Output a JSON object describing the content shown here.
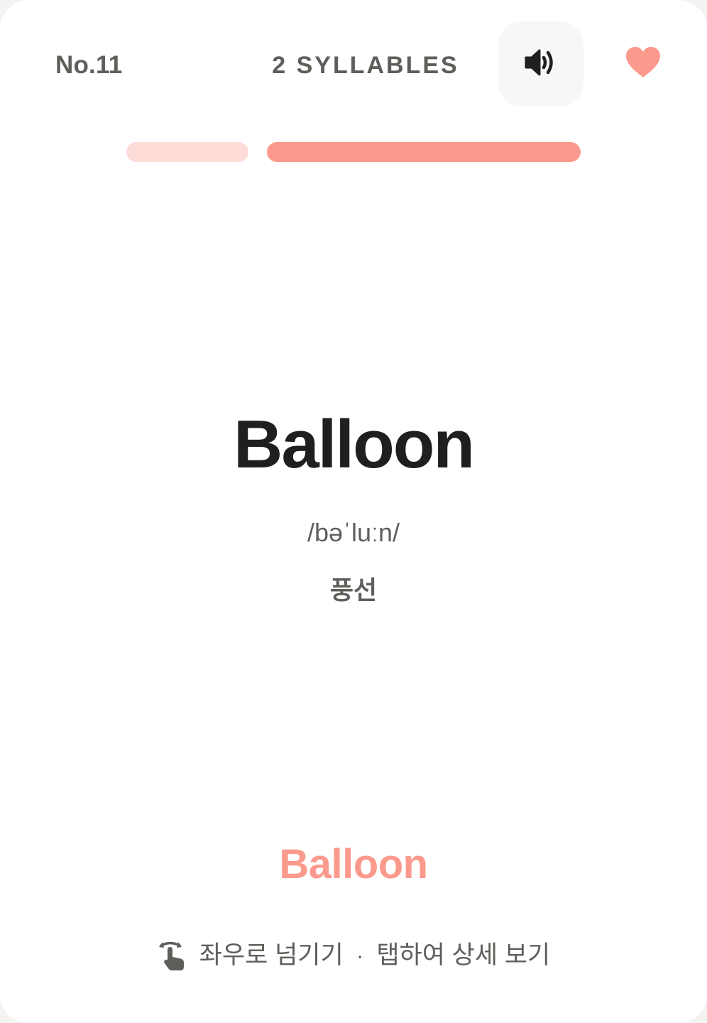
{
  "card": {
    "number": "No.11",
    "syllables_label": "2 SYLLABLES",
    "syllable_count": 2,
    "word": "Balloon",
    "ipa": "/bəˈluːn/",
    "meaning": "풍선",
    "word_accent": "Balloon"
  },
  "controls": {
    "sound_icon": "speaker-icon",
    "favorite_icon": "heart-icon",
    "favorited": true
  },
  "hint": {
    "icon": "swipe-gesture-icon",
    "swipe_text": "좌우로 넘기기",
    "separator": "·",
    "tap_text": "탭하여 상세 보기"
  },
  "colors": {
    "accent": "#fb9a8c",
    "accent_light": "#fddcd7",
    "text_primary": "#1f1f1d",
    "text_secondary": "#5f5e5a",
    "button_bg": "#f7f7f5"
  }
}
